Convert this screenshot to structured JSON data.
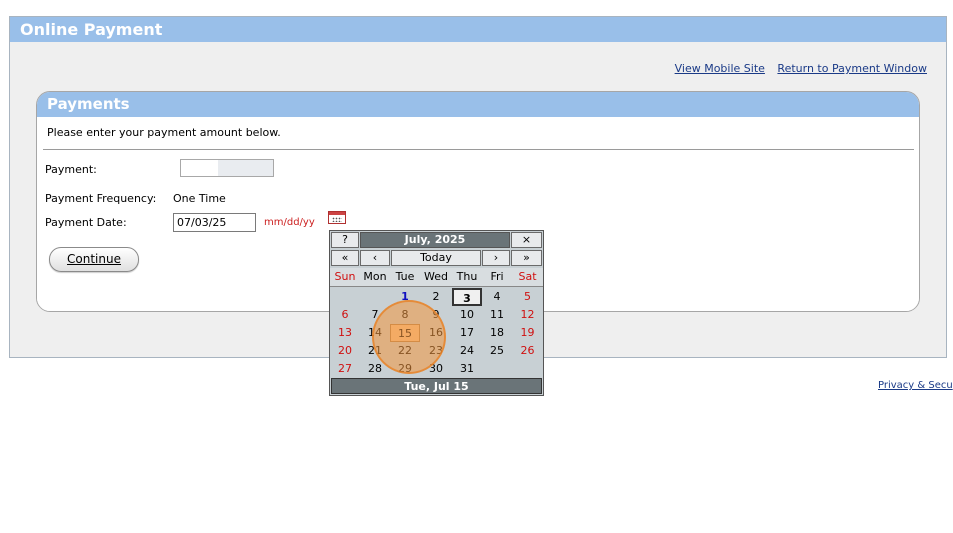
{
  "header": {
    "title": "Online Payment"
  },
  "top_links": {
    "mobile": "View Mobile Site",
    "return": "Return to Payment Window"
  },
  "panel": {
    "title": "Payments",
    "instructions": "Please enter your payment amount below.",
    "payment_label": "Payment:",
    "payment_value": "",
    "frequency_label": "Payment Frequency:",
    "frequency_value": "One Time",
    "date_label": "Payment Date:",
    "date_value": "07/03/25",
    "date_format": "mm/dd/yy",
    "continue_label": "Continue"
  },
  "footer": {
    "privacy": "Privacy & Secu"
  },
  "calendar": {
    "help": "?",
    "title": "July, 2025",
    "close": "×",
    "prev_year": "«",
    "prev_month": "‹",
    "today": "Today",
    "next_month": "›",
    "next_year": "»",
    "weekdays": [
      "Sun",
      "Mon",
      "Tue",
      "Wed",
      "Thu",
      "Fri",
      "Sat"
    ],
    "weeks": [
      [
        "",
        "",
        "1",
        "2",
        "3",
        "4",
        "5"
      ],
      [
        "6",
        "7",
        "8",
        "9",
        "10",
        "11",
        "12"
      ],
      [
        "13",
        "14",
        "15",
        "16",
        "17",
        "18",
        "19"
      ],
      [
        "20",
        "21",
        "22",
        "23",
        "24",
        "25",
        "26"
      ],
      [
        "27",
        "28",
        "29",
        "30",
        "31",
        "",
        ""
      ]
    ],
    "status": "Tue, Jul 15",
    "colors": {
      "weekend": "#d01010",
      "header_bg": "#6a7478",
      "selected": "#f7c596"
    }
  }
}
